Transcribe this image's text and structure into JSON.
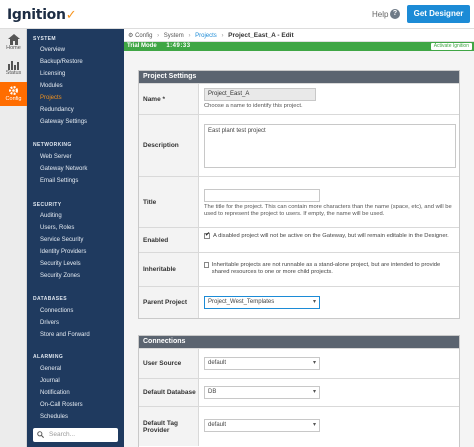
{
  "header": {
    "logo_text": "Ignition",
    "help_label": "Help",
    "help_icon": "?",
    "designer_button": "Get Designer"
  },
  "iconnav": {
    "items": [
      {
        "label": "Home",
        "icon": "home-icon"
      },
      {
        "label": "Status",
        "icon": "bar-chart-icon"
      },
      {
        "label": "Config",
        "icon": "gear-icon",
        "active": true
      }
    ]
  },
  "sidebar": {
    "sections": [
      {
        "title": "SYSTEM",
        "items": [
          "Overview",
          "Backup/Restore",
          "Licensing",
          "Modules",
          "Projects",
          "Redundancy",
          "Gateway Settings"
        ]
      },
      {
        "title": "NETWORKING",
        "items": [
          "Web Server",
          "Gateway Network",
          "Email Settings"
        ]
      },
      {
        "title": "SECURITY",
        "items": [
          "Auditing",
          "Users, Roles",
          "Service Security",
          "Identity Providers",
          "Security Levels",
          "Security Zones"
        ]
      },
      {
        "title": "DATABASES",
        "items": [
          "Connections",
          "Drivers",
          "Store and Forward"
        ]
      },
      {
        "title": "ALARMING",
        "items": [
          "General",
          "Journal",
          "Notification",
          "On-Call Rosters",
          "Schedules"
        ]
      }
    ],
    "active_item": "Projects",
    "search_placeholder": "Search..."
  },
  "breadcrumb": {
    "config": "Config",
    "system": "System",
    "projects": "Projects",
    "current": "Project_East_A - Edit"
  },
  "trial": {
    "label": "Trial Mode",
    "time": "1:49:33",
    "activate": "Activate Ignition"
  },
  "project_settings": {
    "title": "Project Settings",
    "name_label": "Name *",
    "name_value": "Project_East_A",
    "name_help": "Choose a name to identify this project.",
    "description_label": "Description",
    "description_value": "East plant test project",
    "title_label": "Title",
    "title_value": "",
    "title_help": "The title for the project. This can contain more characters than the name (space, etc), and will be used to represent the project to users. If empty, the name will be used.",
    "enabled_label": "Enabled",
    "enabled_help": "A disabled project will not be active on the Gateway, but will remain editable in the Designer.",
    "inheritable_label": "Inheritable",
    "inheritable_help": "Inheritable projects are not runnable as a stand-alone project, but are intended to provide shared resources to one or more child projects.",
    "parent_label": "Parent Project",
    "parent_value": "Project_West_Templates"
  },
  "connections": {
    "title": "Connections",
    "user_source_label": "User Source",
    "user_source_value": "default",
    "default_db_label": "Default Database",
    "default_db_value": "DB",
    "default_tag_label": "Default Tag Provider",
    "default_tag_value": "default"
  },
  "colors": {
    "accent": "#ff6d00",
    "sidebar": "#1f3a5f",
    "trial": "#3fa645",
    "button": "#1c8bd6"
  }
}
